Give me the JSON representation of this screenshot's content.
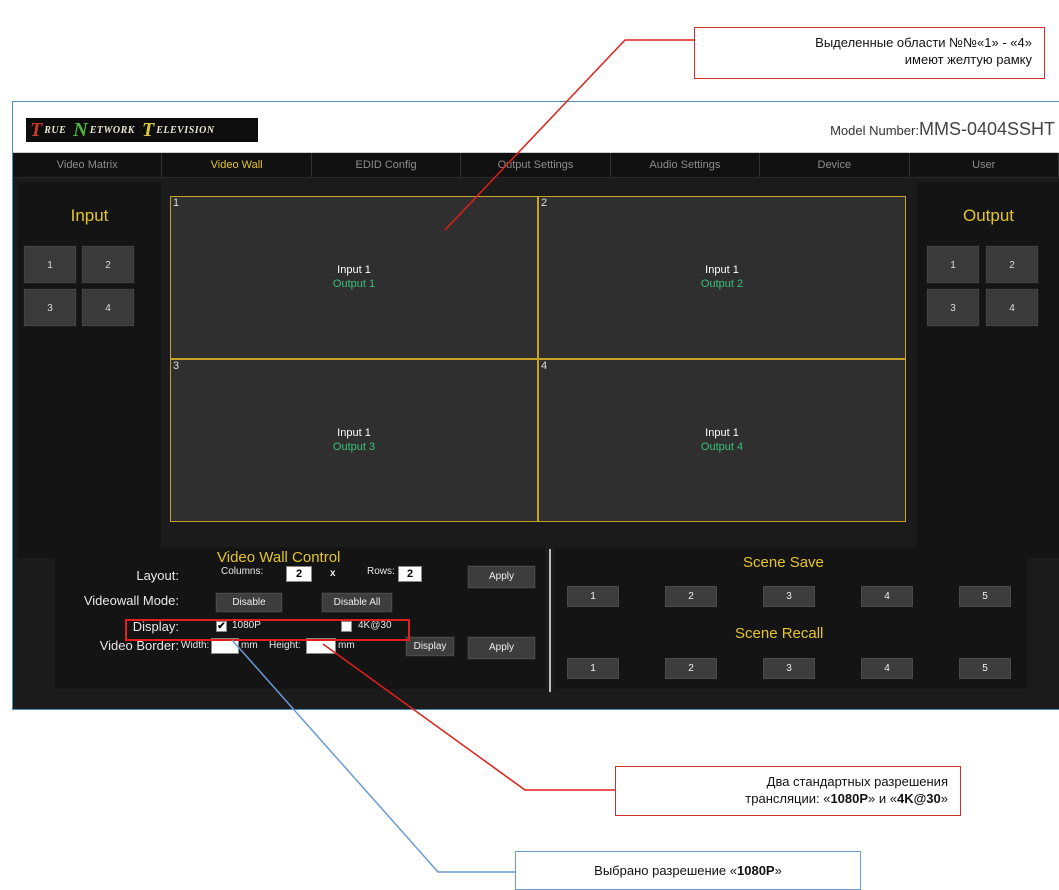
{
  "callouts": {
    "top": {
      "line1": "Выделенные области №№«1» - «4»",
      "line2": "имеют желтую рамку"
    },
    "resolutions": {
      "line1": "Два стандартных разрешения",
      "line2_pre": "трансляции: «",
      "opt1": "1080P",
      "mid": "» и «",
      "opt2": "4K@30",
      "end": "»"
    },
    "selected": {
      "pre": "Выбрано разрешение «",
      "val": "1080P",
      "end": "»"
    }
  },
  "header": {
    "logo": {
      "t": "T",
      "rue": "RUE",
      "n": "N",
      "etwork": "ETWORK",
      "t2": "T",
      "elevision": "ELEVISION"
    },
    "model_label": "Model Number:",
    "model_number": "MMS-0404SSHT"
  },
  "nav": {
    "tabs": [
      "Video Matrix",
      "Video Wall",
      "EDID Config",
      "Output Settings",
      "Audio Settings",
      "Device",
      "User"
    ],
    "active": "Video Wall"
  },
  "input_panel": {
    "title": "Input",
    "buttons": [
      "1",
      "2",
      "3",
      "4"
    ]
  },
  "output_panel": {
    "title": "Output",
    "buttons": [
      "1",
      "2",
      "3",
      "4"
    ]
  },
  "wall": {
    "cells": [
      {
        "num": "1",
        "input": "Input 1",
        "output": "Output 1"
      },
      {
        "num": "2",
        "input": "Input 1",
        "output": "Output 2"
      },
      {
        "num": "3",
        "input": "Input 1",
        "output": "Output 3"
      },
      {
        "num": "4",
        "input": "Input 1",
        "output": "Output 4"
      }
    ]
  },
  "control": {
    "title": "Video Wall Control",
    "layout_label": "Layout:",
    "columns_label": "Columns:",
    "columns_value": "2",
    "x": "x",
    "rows_label": "Rows:",
    "rows_value": "2",
    "apply": "Apply",
    "mode_label": "Videowall Mode:",
    "disable": "Disable",
    "disable_all": "Disable All",
    "display_label": "Display:",
    "res1": "1080P",
    "res1_checked": true,
    "res2": "4K@30",
    "res2_checked": false,
    "border_label": "Video Border:",
    "width_label": "Width:",
    "width_value": "",
    "mm": "mm",
    "height_label": "Height:",
    "height_value": "",
    "display_btn": "Display",
    "apply2": "Apply"
  },
  "scene": {
    "save_title": "Scene Save",
    "recall_title": "Scene Recall",
    "save_buttons": [
      "1",
      "2",
      "3",
      "4",
      "5"
    ],
    "recall_buttons": [
      "1",
      "2",
      "3",
      "4",
      "5"
    ]
  },
  "colors": {
    "accent": "#e3c52a",
    "output_green": "#3bbf7a",
    "cell_border": "#c7a224",
    "callout_red": "#d0302a",
    "callout_blue": "#6b9ad4"
  }
}
